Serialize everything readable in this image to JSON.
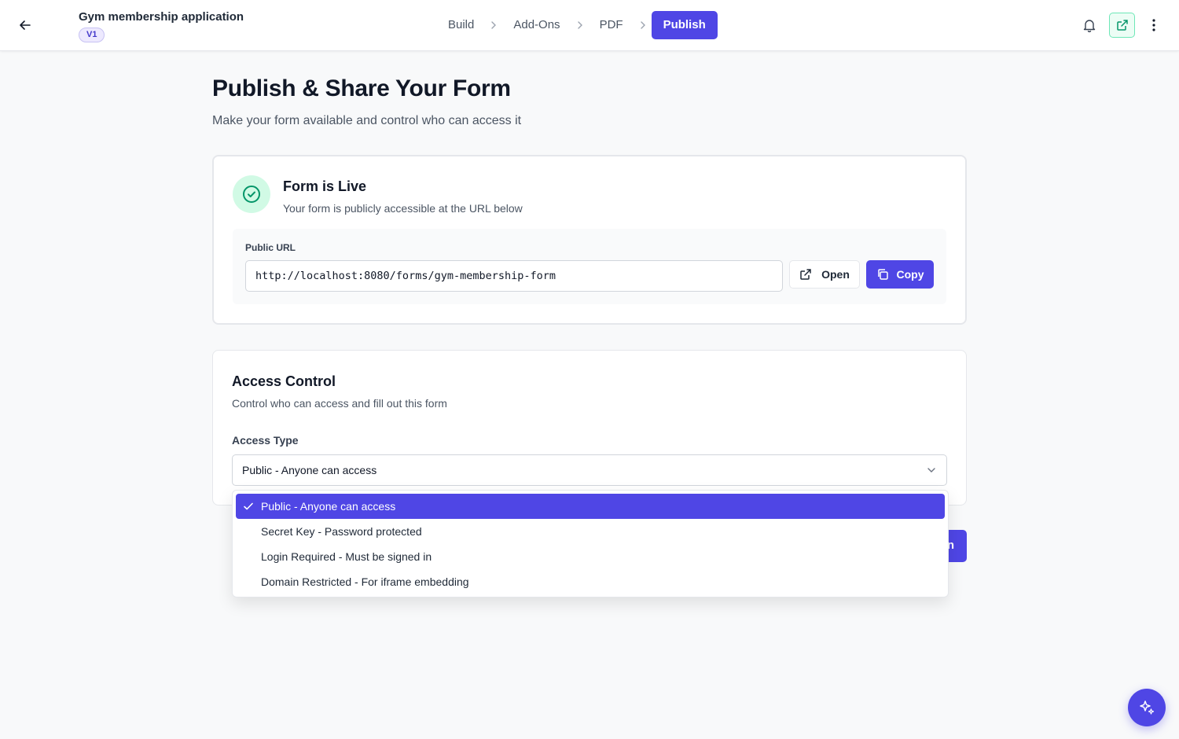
{
  "header": {
    "form_title": "Gym membership application",
    "version": "V1",
    "steps": [
      "Build",
      "Add-Ons",
      "PDF",
      "Publish"
    ],
    "active_step": "Publish"
  },
  "page": {
    "title": "Publish & Share Your Form",
    "subtitle": "Make your form available and control who can access it"
  },
  "live_card": {
    "title": "Form is Live",
    "subtitle": "Your form is publicly accessible at the URL below",
    "url_label": "Public URL",
    "url_value": "http://localhost:8080/forms/gym-membership-form",
    "open_label": "Open",
    "copy_label": "Copy"
  },
  "access": {
    "title": "Access Control",
    "subtitle": "Control who can access and fill out this form",
    "type_label": "Access Type",
    "selected": "Public - Anyone can access",
    "options": [
      "Public - Anyone can access",
      "Secret Key - Password protected",
      "Login Required - Must be signed in",
      "Domain Restricted - For iframe embedding"
    ],
    "partially_hidden_button_text": "n"
  },
  "colors": {
    "primary": "#4f46e5",
    "success_bg": "#d1fae5",
    "success_icon": "#059669",
    "background": "#f8f9fa"
  }
}
